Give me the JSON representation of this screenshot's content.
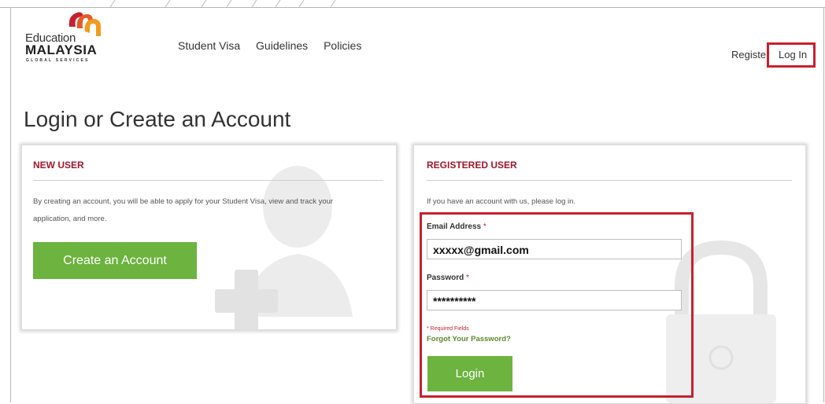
{
  "header": {
    "logo": {
      "line1": "Education",
      "line2": "MALAYSIA",
      "line3": "GLOBAL SERVICES"
    },
    "nav": [
      "Student Visa",
      "Guidelines",
      "Policies"
    ],
    "register_label": "Register",
    "login_label": "Log In"
  },
  "page_title": "Login or Create an Account",
  "new_user": {
    "title": "NEW USER",
    "description_line1": "By creating an account, you will be able to apply for your Student Visa, view and track your",
    "description_line2": "application, and more.",
    "button_label": "Create an Account"
  },
  "registered_user": {
    "title": "REGISTERED USER",
    "intro": "If you have an account with us, please log in.",
    "email_label": "Email Address",
    "email_value": "xxxxx@gmail.com",
    "password_label": "Password",
    "password_value": "**********",
    "required_marker": "*",
    "required_note": "* Required Fields",
    "forgot_label": "Forgot Your Password?",
    "button_label": "Login"
  },
  "colors": {
    "accent_red": "#a4162b",
    "highlight_red": "#c8202f",
    "button_green": "#6db33f",
    "link_green": "#5c8a2a"
  },
  "icons": [
    "logo-mark-icon",
    "user-plus-watermark-icon",
    "padlock-watermark-icon"
  ]
}
